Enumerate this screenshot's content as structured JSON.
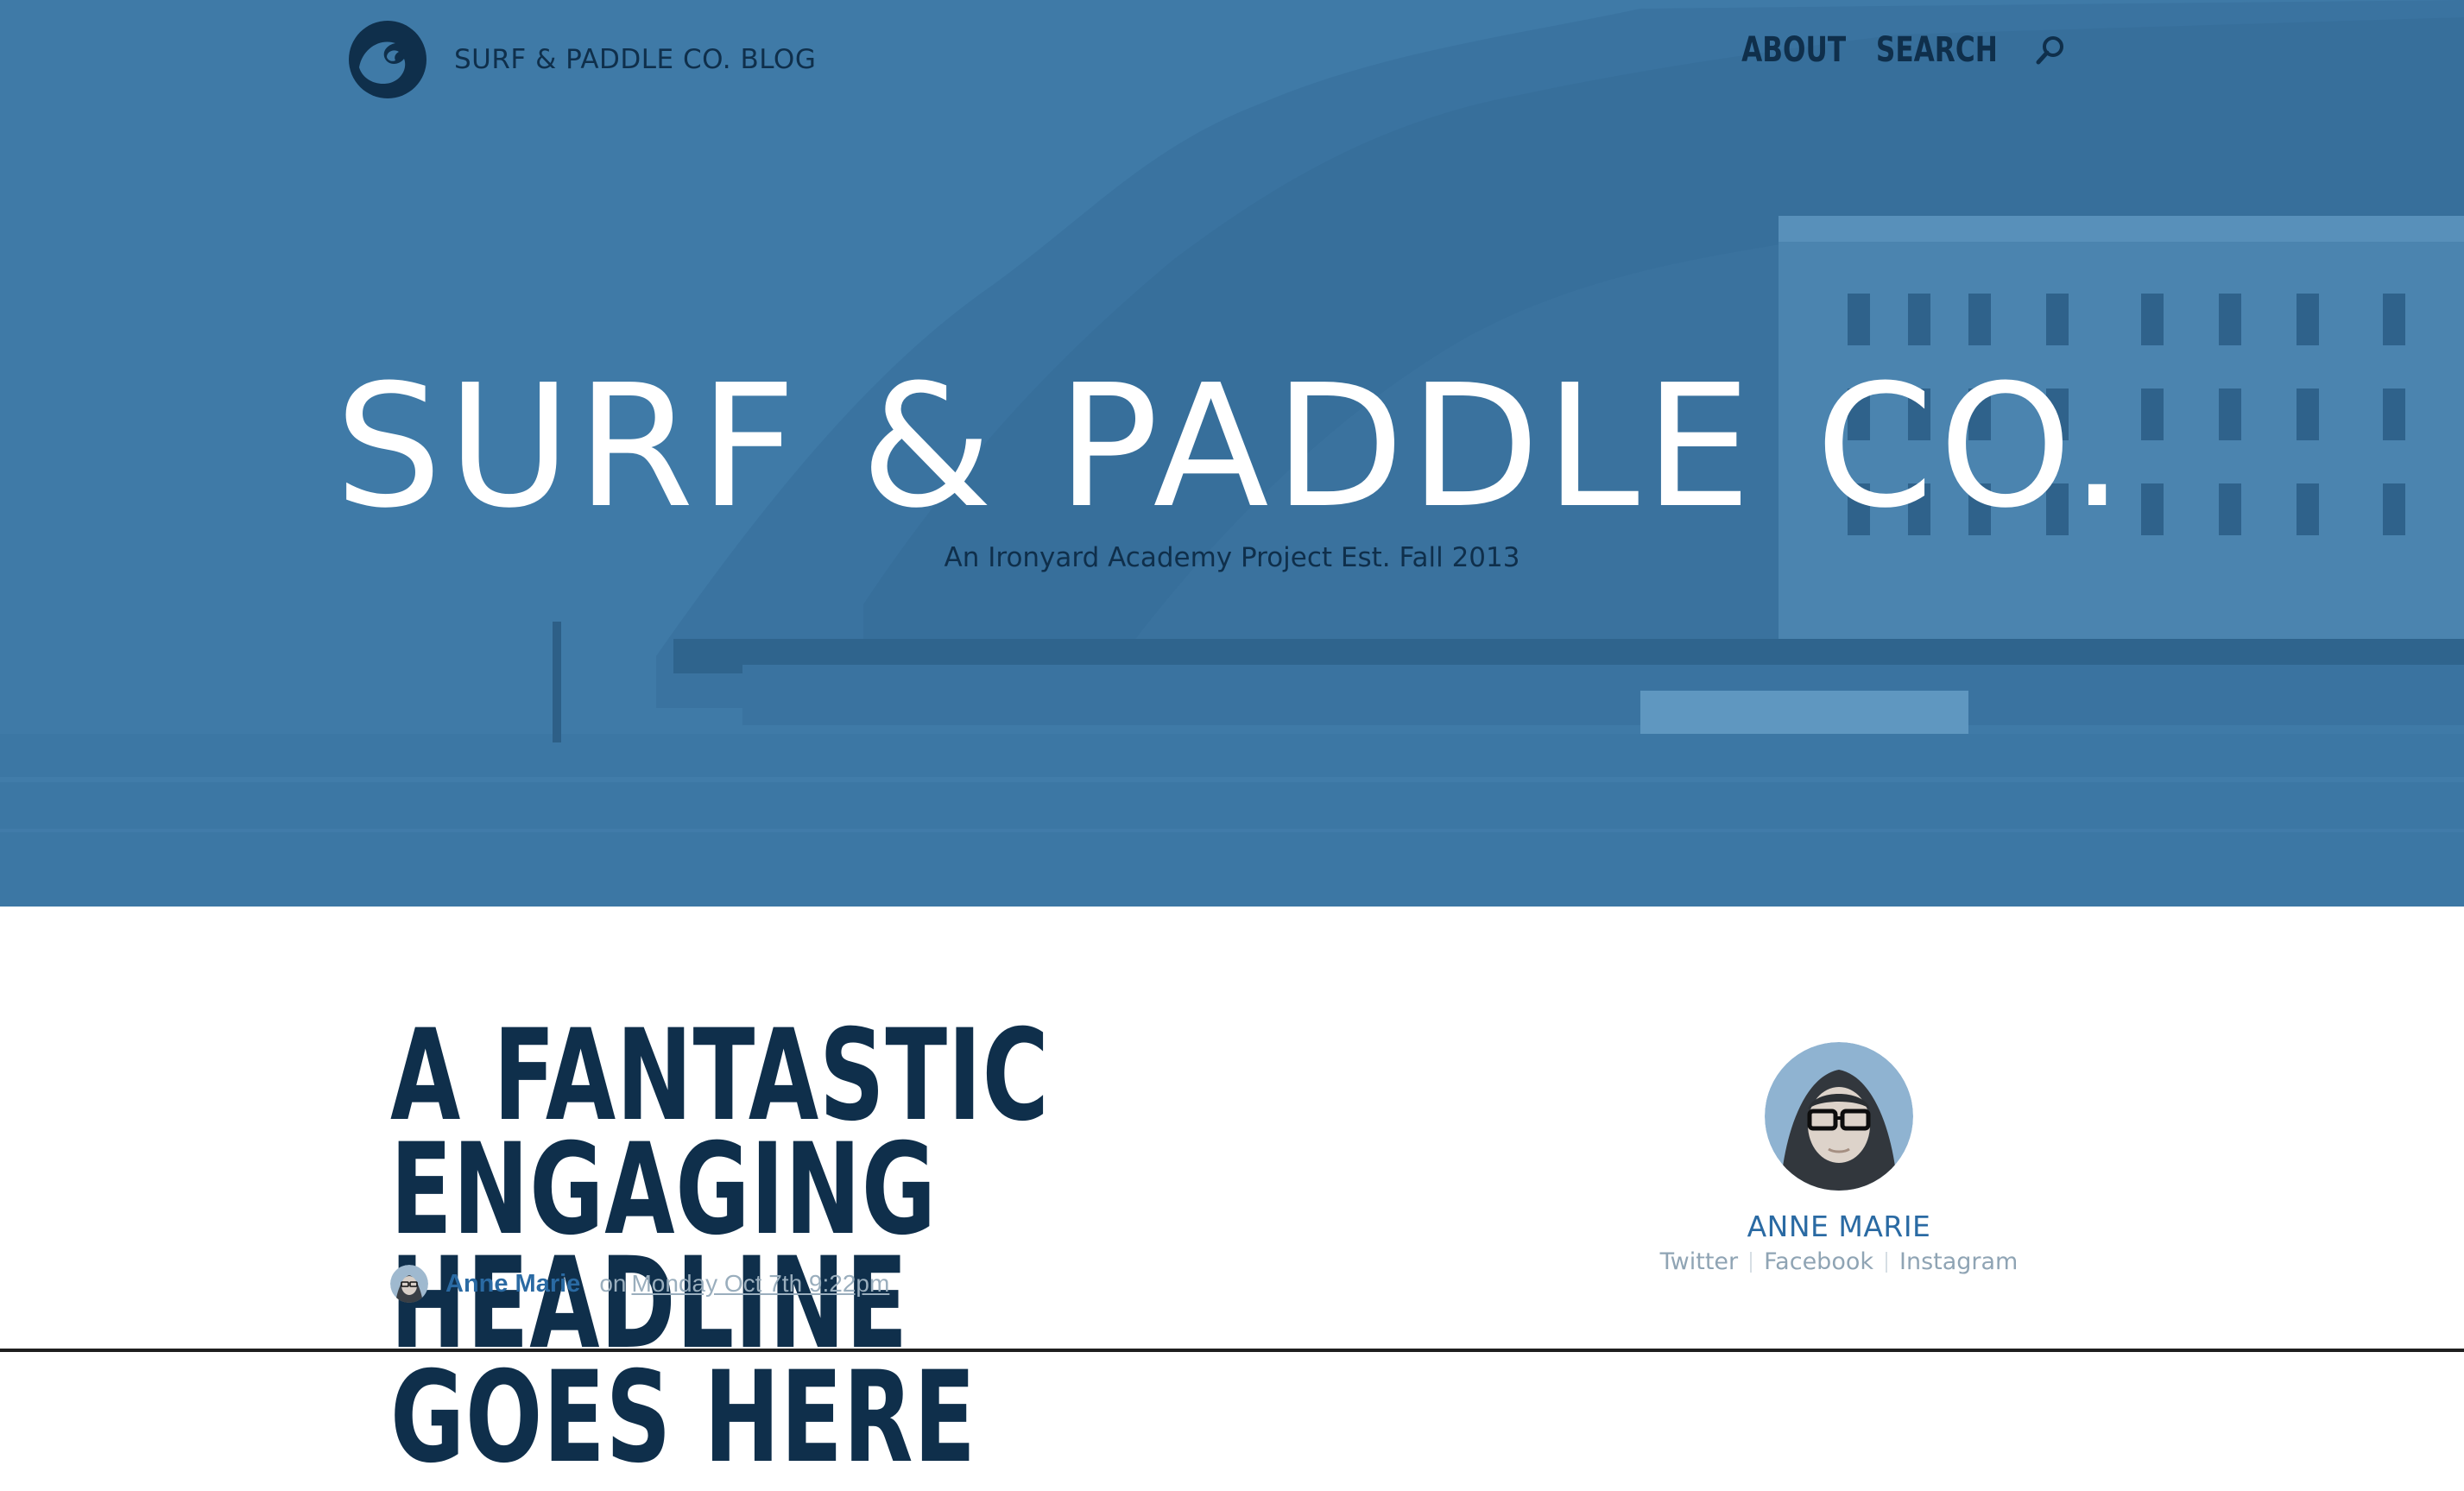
{
  "header": {
    "brand_name": "SURF & PADDLE CO. BLOG",
    "nav": {
      "about": "ABOUT",
      "search": "SEARCH"
    }
  },
  "hero": {
    "title": "SURF & PADDLE CO.",
    "subtitle": "An Ironyard Academy Project Est. Fall 2013"
  },
  "post": {
    "headline_line1": "A FANTASTIC ENGAGING",
    "headline_line2": "HEADLINE GOES HERE",
    "author": "Anne Marie",
    "on_label": "on",
    "date": "Monday Oct 7th 9:22pm"
  },
  "author_card": {
    "name": "ANNE MARIE",
    "socials": [
      "Twitter",
      "Facebook",
      "Instagram"
    ]
  },
  "colors": {
    "hero_blue": "#3f7aa7",
    "navy": "#0f2f4b",
    "link_blue": "#2a6aa3",
    "muted": "#9aaebd"
  },
  "icons": [
    "wave-logo-icon",
    "search-icon",
    "avatar"
  ]
}
